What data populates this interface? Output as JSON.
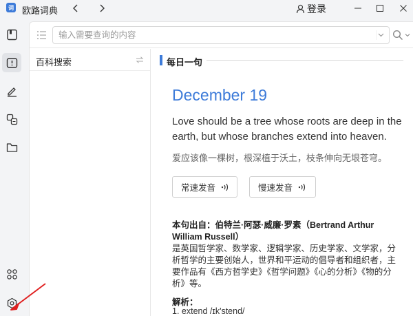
{
  "titlebar": {
    "logo_text": "词",
    "title": "欧路词典",
    "login_label": "登录"
  },
  "search": {
    "placeholder": "输入需要查询的内容",
    "value": ""
  },
  "left_panel": {
    "encyclopedia_label": "百科搜索"
  },
  "daily": {
    "section_title": "每日一句",
    "date": "December 19",
    "sentence_en": "Love should be a tree whose roots are deep in the earth, but whose branches extend into heaven.",
    "sentence_zh": "爱应该像一棵树，根深植于沃土，枝条伸向无垠苍穹。",
    "normal_speed_label": "常速发音",
    "slow_speed_label": "慢速发音",
    "source": "本句出自：伯特兰·阿瑟·威廉·罗素（Bertrand Arthur William Russell）",
    "bio": "是英国哲学家、数学家、逻辑学家、历史学家、文学家，分析哲学的主要创始人，世界和平运动的倡导者和组织者，主要作品有《西方哲学史》《哲学问题》《心的分析》《物的分析》等。",
    "analysis_heading": "解析：",
    "analysis_first_line": "1. extend /ɪk'stend/"
  },
  "colors": {
    "accent": "#3d7bd9",
    "annotation_arrow": "#e02020"
  },
  "icons": {
    "rail": [
      "notebook-icon",
      "flashcard-icon",
      "edit-icon",
      "translate-icon",
      "folder-icon",
      "apps-icon",
      "settings-icon"
    ]
  }
}
